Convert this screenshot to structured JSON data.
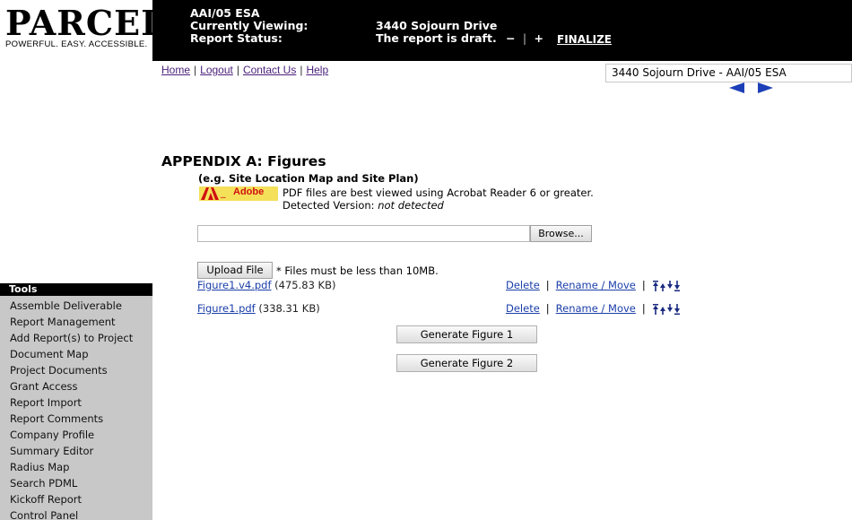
{
  "logo": {
    "title": "PARCEL",
    "tagline": "POWERFUL. EASY. ACCESSIBLE."
  },
  "header": {
    "report_id": "AAI/05 ESA",
    "viewing_label": "Currently Viewing:",
    "viewing_value": "3440 Sojourn Drive",
    "status_label": "Report Status:",
    "status_value": "The report is draft.",
    "minus_label": "−",
    "divider": "|",
    "plus_label": "+",
    "finalize_label": "FINALIZE"
  },
  "topnav": {
    "home": "Home",
    "logout": "Logout",
    "contact": "Contact Us",
    "help": "Help",
    "sep": "|"
  },
  "project_selector": {
    "value": "3440 Sojourn Drive - AAI/05 ESA"
  },
  "colors": {
    "header_bg": "#000000",
    "link": "#1a3ea8",
    "nav_link": "#4a1f7a",
    "arrow": "#1c3fb8",
    "sidebar_bg": "#c8c8c8"
  },
  "main": {
    "title": "APPENDIX A: Figures",
    "subtitle": "(e.g. Site Location Map and Site Plan)",
    "adobe_label": "Adobe",
    "pdf_note": "PDF files are best viewed using Acrobat Reader 6 or greater.",
    "detected_label": "Detected Version:",
    "detected_value": "not detected",
    "browse_label": "Browse...",
    "upload_label": "Upload File",
    "upload_note": "* Files must be less than 10MB.",
    "files": [
      {
        "name": "Figure1.v4.pdf",
        "size": "(475.83 KB)",
        "delete": "Delete",
        "rename": "Rename / Move"
      },
      {
        "name": "Figure1.pdf",
        "size": "(338.31 KB)",
        "delete": "Delete",
        "rename": "Rename / Move"
      }
    ],
    "gen_buttons": [
      "Generate Figure 1",
      "Generate Figure 2"
    ]
  },
  "tools": {
    "heading": "Tools",
    "items": [
      "Assemble Deliverable",
      "Report Management",
      "Add Report(s) to Project",
      "Document Map",
      "Project Documents",
      "Grant Access",
      "Report Import",
      "Report Comments",
      "Company Profile",
      "Summary Editor",
      "Radius Map",
      "Search PDML",
      "Kickoff Report",
      "Control Panel"
    ]
  }
}
